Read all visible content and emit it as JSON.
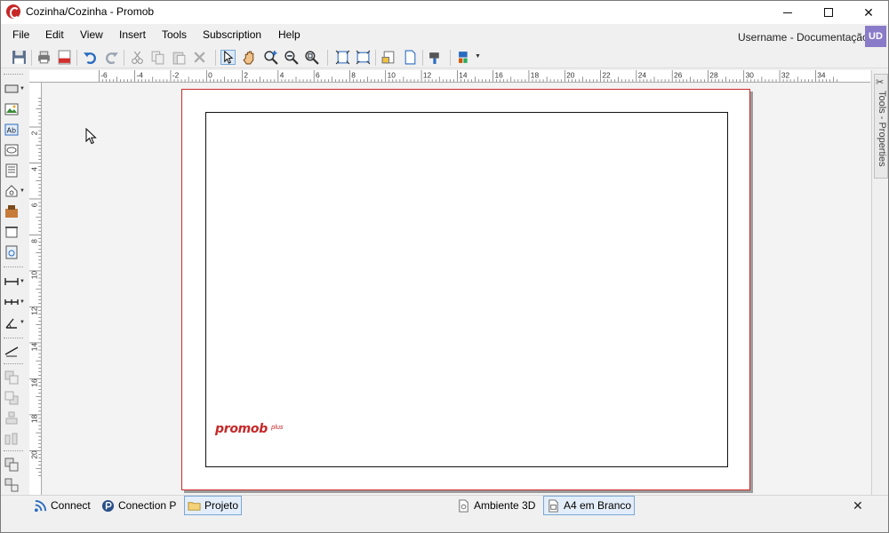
{
  "window": {
    "title": "Cozinha/Cozinha - Promob",
    "min_symbol": "",
    "close_symbol": "✕"
  },
  "menu": [
    {
      "label": "File"
    },
    {
      "label": "Edit"
    },
    {
      "label": "View"
    },
    {
      "label": "Insert"
    },
    {
      "label": "Tools"
    },
    {
      "label": "Subscription"
    },
    {
      "label": "Help"
    }
  ],
  "user": {
    "name": "Username - Documentação",
    "initials": "UD",
    "badge_color": "#8a7bc9"
  },
  "toolbar_icons": [
    "save-icon",
    "print-icon",
    "pdf-icon",
    "undo-icon",
    "redo-icon",
    "cut-icon",
    "copy-icon",
    "paste-icon",
    "delete-icon",
    "select-pointer-icon",
    "pan-hand-icon",
    "zoom-in-icon",
    "zoom-out-icon",
    "zoom-window-icon",
    "fit-page-icon",
    "fit-width-icon",
    "page-setup-icon",
    "new-page-icon",
    "properties-icon",
    "layout-style-icon"
  ],
  "ruler": {
    "h_labels": [
      "-6",
      "-4",
      "-2",
      "0",
      "2",
      "4",
      "6",
      "8",
      "10",
      "12",
      "14",
      "16",
      "18",
      "20",
      "22",
      "24",
      "26",
      "28",
      "30",
      "32",
      "34"
    ],
    "v_labels": [
      "2",
      "4",
      "6",
      "8",
      "10",
      "12",
      "14",
      "16",
      "18",
      "20"
    ]
  },
  "sheet": {
    "brand": "promob",
    "brand_suffix": "plus",
    "brand_color": "#c62828"
  },
  "side_panel": {
    "label": "Tools - Properties"
  },
  "bottom_tabs": [
    {
      "label": "Connect"
    },
    {
      "label": "Conection P"
    },
    {
      "label": "Projeto"
    },
    {
      "label": "Ambiente 3D"
    },
    {
      "label": "A4 em Branco"
    }
  ],
  "bottom_close": "✕"
}
